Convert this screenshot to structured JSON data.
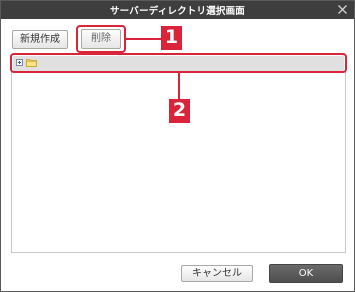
{
  "dialog": {
    "title": "サーバーディレクトリ選択画面"
  },
  "toolbar": {
    "new_label": "新規作成",
    "delete_label": "削除"
  },
  "annotations": {
    "badge_1": "1",
    "badge_2": "2",
    "color": "#d9243a"
  },
  "tree": {
    "items": [
      {
        "expand_icon": "plus-box-icon",
        "folder_icon": "folder-icon",
        "label": ""
      }
    ]
  },
  "footer": {
    "cancel_label": "キャンセル",
    "ok_label": "OK"
  }
}
